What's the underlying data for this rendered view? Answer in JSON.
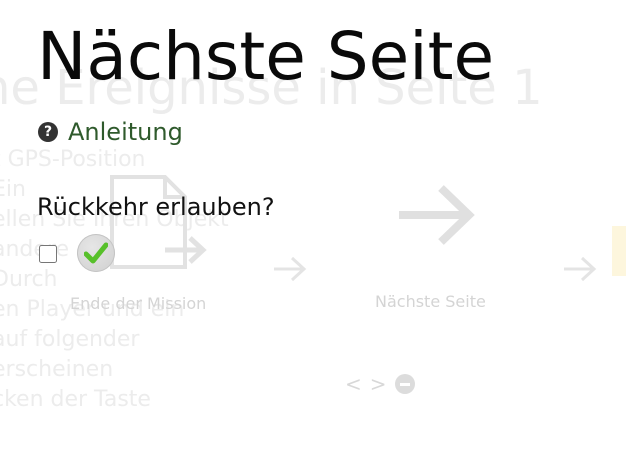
{
  "background": {
    "faded_title": "ne Ereignisse in Seite 1",
    "faded_lines": [
      "t GPS-Position",
      "Ein",
      "ellen Sie Ihren Objekt",
      "andere",
      "Durch",
      "en Player und ein",
      "auf folgender",
      "erscheinen",
      "cken der Taste"
    ],
    "end_caption": "Ende der Mission",
    "next_caption": "Nächste Seite",
    "nav_prev": "<",
    "nav_next": ">"
  },
  "page": {
    "title": "Nächste Seite",
    "help_label": "Anleitung",
    "allow_return_label": "Rückkehr erlauben?",
    "allow_return_checked": false
  },
  "icons": {
    "help": "question-circle-icon",
    "confirm": "checkmark-icon"
  },
  "colors": {
    "help_link": "#2f5a2c",
    "check_green": "#57c02a"
  }
}
